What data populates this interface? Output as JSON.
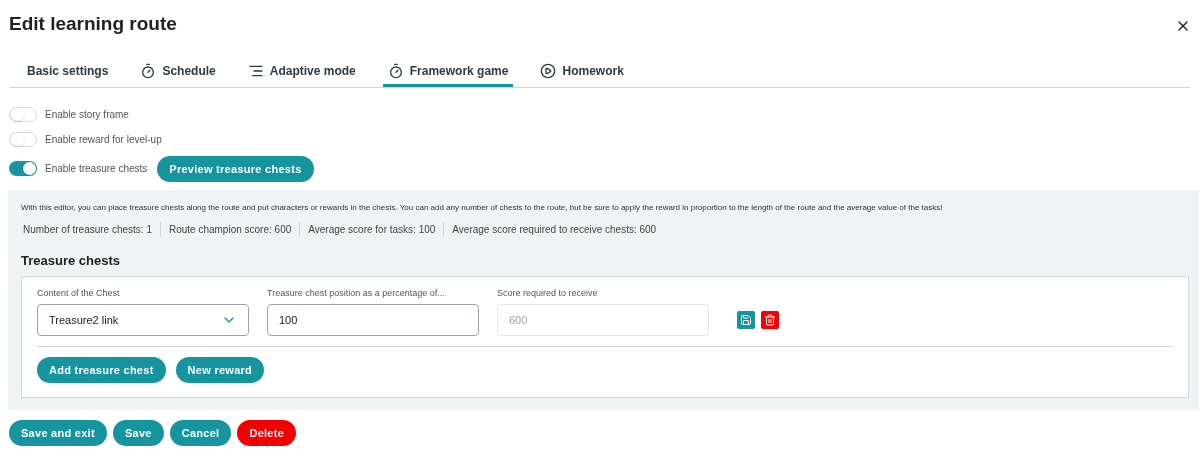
{
  "title": "Edit learning route",
  "tabs": [
    {
      "label": "Basic settings",
      "kind": "none",
      "selected": false
    },
    {
      "label": "Schedule",
      "kind": "timer",
      "selected": false
    },
    {
      "label": "Adaptive mode",
      "kind": "lines",
      "selected": false
    },
    {
      "label": "Framework game",
      "kind": "timer",
      "selected": true
    },
    {
      "label": "Homework",
      "kind": "play",
      "selected": false
    }
  ],
  "toggles": [
    {
      "label": "Enable story frame",
      "on": false
    },
    {
      "label": "Enable reward for level-up",
      "on": false
    },
    {
      "label": "Enable treasure chests",
      "on": true
    }
  ],
  "preview_button": "Preview treasure chests",
  "info": "With this editor, you can place treasure chests along the route and put characters or rewards in the chests. You can add any number of chests to the route, but be sure to apply the reward in proportion to the length of the route and the average value of the tasks!",
  "stats": [
    "Number of treasure chests: 1",
    "Route champion score: 600",
    "Average score for tasks: 100",
    "Average score required to receive chests: 600"
  ],
  "section_title": "Treasure chests",
  "chest": {
    "content_label": "Content of the Chest",
    "content_value": "Treasure2 link",
    "position_label": "Treasure chest position as a percentage of...",
    "position_value": "100",
    "score_label": "Score required to receive",
    "score_placeholder": "600"
  },
  "card_buttons": [
    "Add treasure chest",
    "New reward"
  ],
  "footer_buttons": [
    {
      "label": "Save and exit",
      "kind": "primary"
    },
    {
      "label": "Save",
      "kind": "primary"
    },
    {
      "label": "Cancel",
      "kind": "primary"
    },
    {
      "label": "Delete",
      "kind": "danger"
    }
  ]
}
